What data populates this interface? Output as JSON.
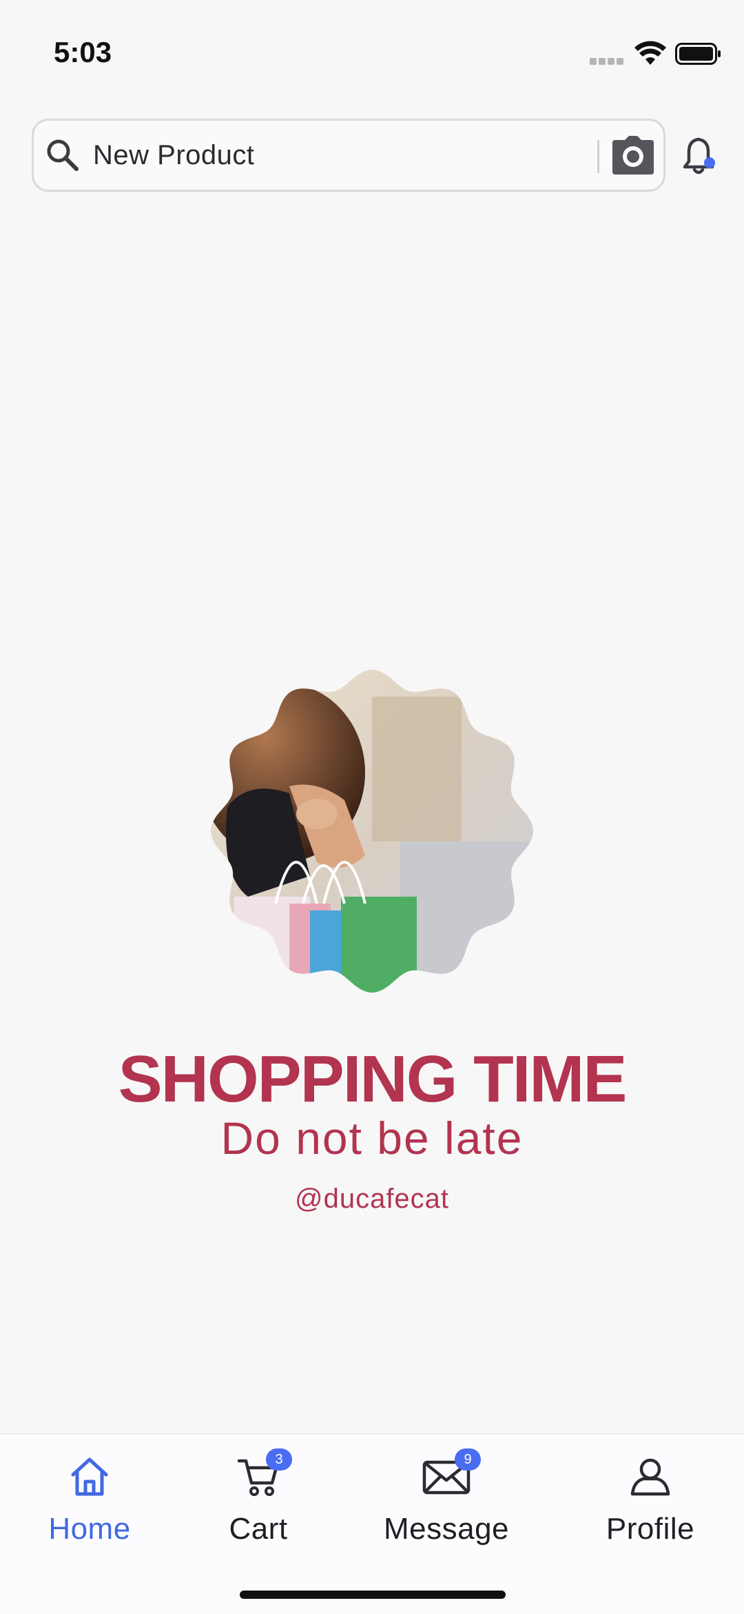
{
  "status_bar": {
    "time": "5:03"
  },
  "search": {
    "value": "New Product"
  },
  "hero": {
    "title": "SHOPPING TIME",
    "subtitle": "Do not be late",
    "handle": "@ducafecat"
  },
  "nav": {
    "items": [
      {
        "label": "Home",
        "active": true
      },
      {
        "label": "Cart",
        "badge": "3"
      },
      {
        "label": "Message",
        "badge": "9"
      },
      {
        "label": "Profile"
      }
    ]
  },
  "colors": {
    "accent": "#4169e1",
    "brand": "#b2344f",
    "badge": "#4a6cf0"
  }
}
